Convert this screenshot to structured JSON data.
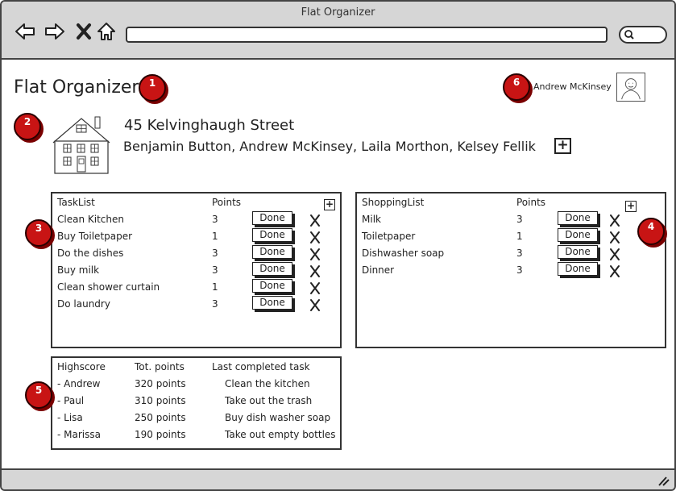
{
  "window": {
    "title": "Flat Organizer"
  },
  "app": {
    "title": "Flat Organizer"
  },
  "user": {
    "name": "Andrew McKinsey"
  },
  "flat": {
    "address": "45 Kelvinghaugh Street",
    "members": "Benjamin Button, Andrew McKinsey, Laila Morthon, Kelsey Fellik",
    "add_label": "+"
  },
  "tasks": {
    "header_name": "TaskList",
    "header_points": "Points",
    "add_label": "+",
    "done_label": "Done",
    "rows": [
      {
        "name": "Clean Kitchen",
        "points": "3"
      },
      {
        "name": "Buy Toiletpaper",
        "points": "1"
      },
      {
        "name": "Do the dishes",
        "points": "3"
      },
      {
        "name": "Buy milk",
        "points": "3"
      },
      {
        "name": "Clean shower curtain",
        "points": "1"
      },
      {
        "name": "Do laundry",
        "points": "3"
      }
    ]
  },
  "shopping": {
    "header_name": "ShoppingList",
    "header_points": "Points",
    "add_label": "+",
    "done_label": "Done",
    "rows": [
      {
        "name": "Milk",
        "points": "3"
      },
      {
        "name": "Toiletpaper",
        "points": "1"
      },
      {
        "name": "Dishwasher soap",
        "points": "3"
      },
      {
        "name": "Dinner",
        "points": "3"
      }
    ]
  },
  "highscore": {
    "header_name": "Highscore",
    "header_points": "Tot. points",
    "header_task": "Last completed task",
    "rows": [
      {
        "name": "- Andrew",
        "points": "320 points",
        "task": "Clean the kitchen"
      },
      {
        "name": "- Paul",
        "points": "310 points",
        "task": "Take out the trash"
      },
      {
        "name": "- Lisa",
        "points": "250 points",
        "task": "Buy dish washer soap"
      },
      {
        "name": "- Marissa",
        "points": "190 points",
        "task": "Take out empty bottles"
      }
    ]
  },
  "markers": [
    "1",
    "2",
    "3",
    "4",
    "5",
    "6"
  ],
  "colors": {
    "marker": "#c81414",
    "chrome": "#d6d6d6"
  },
  "icons": [
    "back-icon",
    "forward-icon",
    "close-icon",
    "home-icon",
    "search-icon",
    "house-icon",
    "avatar-icon",
    "delete-icon",
    "resize-icon"
  ]
}
